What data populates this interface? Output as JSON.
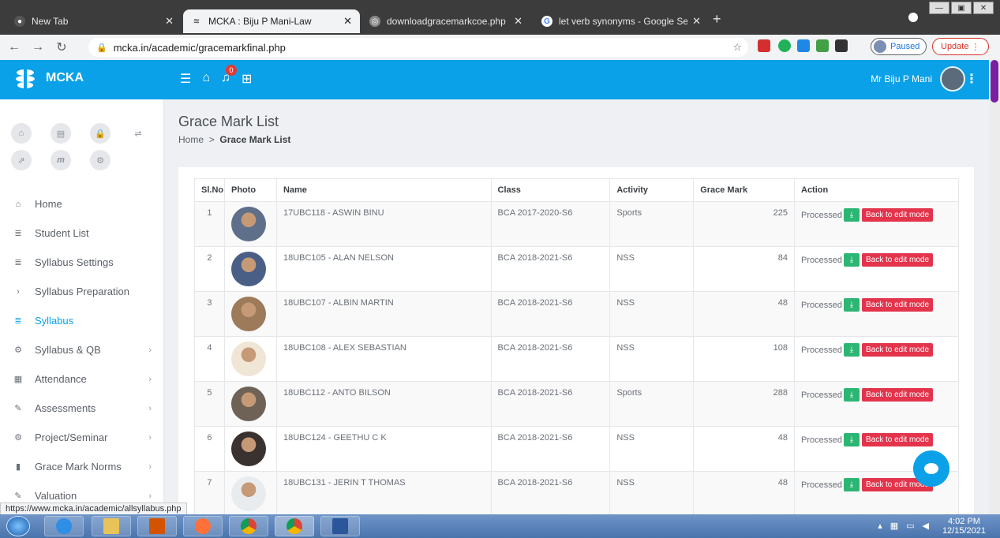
{
  "browser": {
    "tabs": [
      {
        "title": "New Tab",
        "active": false
      },
      {
        "title": "MCKA : Biju P Mani-Law",
        "active": true
      },
      {
        "title": "downloadgracemarkcoe.php",
        "active": false
      },
      {
        "title": "let verb synonyms - Google Searc",
        "active": false
      }
    ],
    "url": "mcka.in/academic/gracemarkfinal.php",
    "paused_label": "Paused",
    "update_label": "Update",
    "status_url": "https://www.mcka.in/academic/allsyllabus.php"
  },
  "header": {
    "brand": "MCKA",
    "notification_count": "0",
    "user_name": "Mr Biju P Mani"
  },
  "sidebar": {
    "items": [
      {
        "label": "Home",
        "icon": "home-icon",
        "chevron": false,
        "active": false
      },
      {
        "label": "Student List",
        "icon": "list-icon",
        "chevron": false,
        "active": false
      },
      {
        "label": "Syllabus Settings",
        "icon": "list-icon",
        "chevron": false,
        "active": false
      },
      {
        "label": "Syllabus Preparation",
        "icon": "chevron-right-icon",
        "chevron": false,
        "active": false
      },
      {
        "label": "Syllabus",
        "icon": "list-icon",
        "chevron": false,
        "active": true
      },
      {
        "label": "Syllabus & QB",
        "icon": "cogs-icon",
        "chevron": true,
        "active": false
      },
      {
        "label": "Attendance",
        "icon": "calendar-icon",
        "chevron": true,
        "active": false
      },
      {
        "label": "Assessments",
        "icon": "pencil-icon",
        "chevron": true,
        "active": false
      },
      {
        "label": "Project/Seminar",
        "icon": "cogs-icon",
        "chevron": true,
        "active": false
      },
      {
        "label": "Grace Mark Norms",
        "icon": "book-icon",
        "chevron": true,
        "active": false
      },
      {
        "label": "Valuation",
        "icon": "pencil-icon",
        "chevron": true,
        "active": false
      }
    ]
  },
  "page": {
    "title": "Grace Mark List",
    "breadcrumb_home": "Home",
    "breadcrumb_sep": ">",
    "breadcrumb_current": "Grace Mark List"
  },
  "table": {
    "headers": [
      "Sl.No",
      "Photo",
      "Name",
      "Class",
      "Activity",
      "Grace Mark",
      "Action"
    ],
    "status_label": "Processed",
    "edit_label": "Back to edit mode",
    "rows": [
      {
        "sl": "1",
        "name": "17UBC118 - ASWIN BINU",
        "class": "BCA 2017-2020-S6",
        "activity": "Sports",
        "grace": "225"
      },
      {
        "sl": "2",
        "name": "18UBC105 - ALAN NELSON",
        "class": "BCA 2018-2021-S6",
        "activity": "NSS",
        "grace": "84"
      },
      {
        "sl": "3",
        "name": "18UBC107 - ALBIN MARTIN",
        "class": "BCA 2018-2021-S6",
        "activity": "NSS",
        "grace": "48"
      },
      {
        "sl": "4",
        "name": "18UBC108 - ALEX SEBASTIAN",
        "class": "BCA 2018-2021-S6",
        "activity": "NSS",
        "grace": "108"
      },
      {
        "sl": "5",
        "name": "18UBC112 - ANTO BILSON",
        "class": "BCA 2018-2021-S6",
        "activity": "Sports",
        "grace": "288"
      },
      {
        "sl": "6",
        "name": "18UBC124 - GEETHU C K",
        "class": "BCA 2018-2021-S6",
        "activity": "NSS",
        "grace": "48"
      },
      {
        "sl": "7",
        "name": "18UBC131 - JERIN T THOMAS",
        "class": "BCA 2018-2021-S6",
        "activity": "NSS",
        "grace": "48"
      }
    ]
  },
  "taskbar": {
    "time": "4:02 PM",
    "date": "12/15/2021"
  },
  "colors": {
    "brand_blue": "#0aa1e8",
    "processed_green": "#2bb673",
    "edit_red": "#e3344c"
  }
}
